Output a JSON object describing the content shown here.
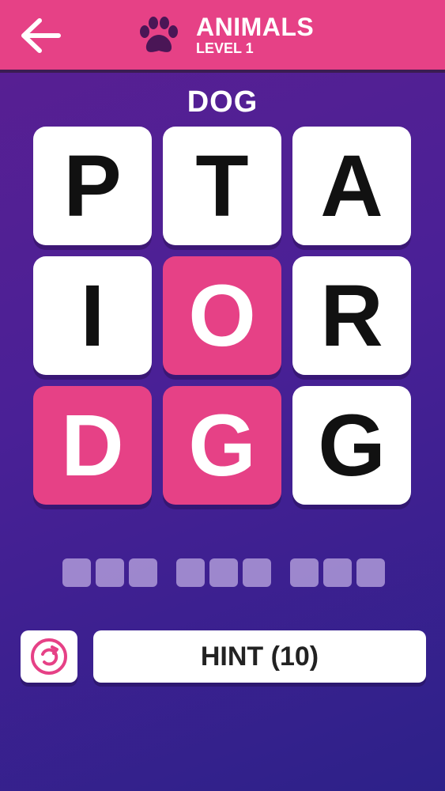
{
  "header": {
    "category": "ANIMALS",
    "level": "LEVEL 1",
    "back_icon": "arrow-left-icon",
    "category_icon": "paw-icon"
  },
  "target_word": "DOG",
  "grid": {
    "rows": [
      [
        {
          "letter": "P",
          "selected": false
        },
        {
          "letter": "T",
          "selected": false
        },
        {
          "letter": "A",
          "selected": false
        }
      ],
      [
        {
          "letter": "I",
          "selected": false
        },
        {
          "letter": "O",
          "selected": true
        },
        {
          "letter": "R",
          "selected": false
        }
      ],
      [
        {
          "letter": "D",
          "selected": true
        },
        {
          "letter": "G",
          "selected": true
        },
        {
          "letter": "G",
          "selected": false
        }
      ]
    ]
  },
  "answer_slots": {
    "groups": [
      3,
      3,
      3
    ]
  },
  "controls": {
    "restart_icon": "restart-icon",
    "hint_label": "HINT (10)"
  },
  "colors": {
    "accent": "#e64186",
    "tile": "#ffffff",
    "slot": "#b9a4df"
  }
}
